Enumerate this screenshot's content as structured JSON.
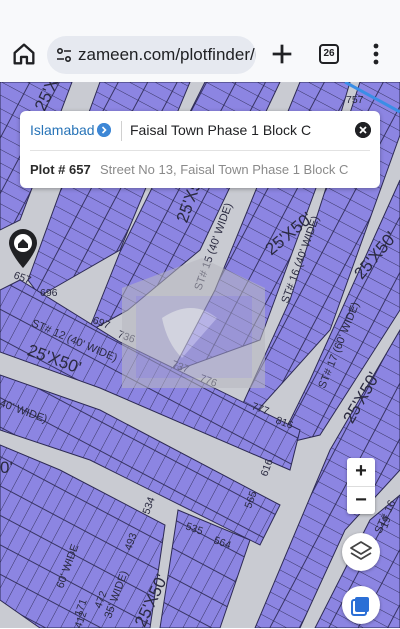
{
  "browser": {
    "url": "zameen.com/plotfinder/l",
    "tab_count": "26"
  },
  "search_card": {
    "city": "Islamabad",
    "query": "Faisal Town Phase 1 Block C",
    "plot_number": "Plot # 657",
    "address": "Street No 13, Faisal Town Phase 1 Block C"
  },
  "map": {
    "roads": [
      "ST# 15 (40' WIDE)",
      "ST# 16 (40' WIDE)",
      "ST# 12 (40' WIDE)",
      "ST# 17 (60' WIDE)",
      "40' WIDE)",
      "60' WIDE",
      "35' WIDE)",
      "ST# 16"
    ],
    "plot_sizes": [
      "25'X50'",
      "25'X50'",
      "25'X50'",
      "25'X50'",
      "25'X50'",
      "25'X50'",
      "25'X50'",
      "25'X50'",
      "0'",
      "25'X50'"
    ],
    "plot_numbers": [
      "696",
      "757",
      "697",
      "736",
      "737",
      "776",
      "777",
      "816",
      "657",
      "696",
      "565",
      "616",
      "493",
      "534",
      "535",
      "564",
      "171",
      "472",
      "412",
      "19"
    ]
  },
  "controls": {
    "zoom_in": "+",
    "zoom_out": "−"
  },
  "colors": {
    "plot_fill": "#8c85e2",
    "road": "#c9cbd2",
    "grid_line": "#2d2a55",
    "accent_blue": "#2874b8"
  }
}
